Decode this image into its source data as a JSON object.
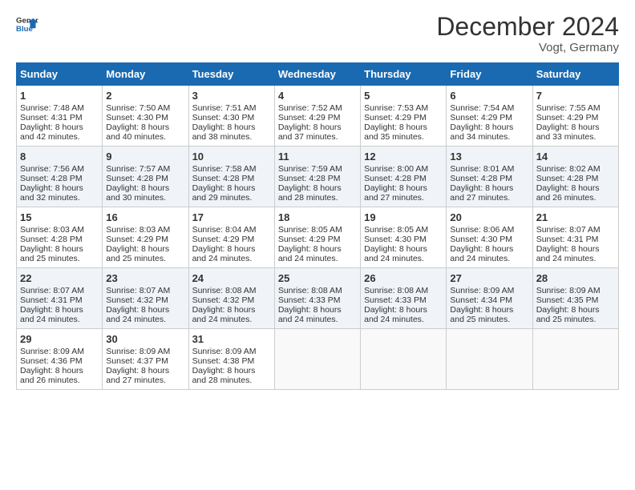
{
  "header": {
    "logo_line1": "General",
    "logo_line2": "Blue",
    "month": "December 2024",
    "location": "Vogt, Germany"
  },
  "days_of_week": [
    "Sunday",
    "Monday",
    "Tuesday",
    "Wednesday",
    "Thursday",
    "Friday",
    "Saturday"
  ],
  "weeks": [
    [
      {
        "day": "1",
        "sunrise": "Sunrise: 7:48 AM",
        "sunset": "Sunset: 4:31 PM",
        "daylight": "Daylight: 8 hours and 42 minutes."
      },
      {
        "day": "2",
        "sunrise": "Sunrise: 7:50 AM",
        "sunset": "Sunset: 4:30 PM",
        "daylight": "Daylight: 8 hours and 40 minutes."
      },
      {
        "day": "3",
        "sunrise": "Sunrise: 7:51 AM",
        "sunset": "Sunset: 4:30 PM",
        "daylight": "Daylight: 8 hours and 38 minutes."
      },
      {
        "day": "4",
        "sunrise": "Sunrise: 7:52 AM",
        "sunset": "Sunset: 4:29 PM",
        "daylight": "Daylight: 8 hours and 37 minutes."
      },
      {
        "day": "5",
        "sunrise": "Sunrise: 7:53 AM",
        "sunset": "Sunset: 4:29 PM",
        "daylight": "Daylight: 8 hours and 35 minutes."
      },
      {
        "day": "6",
        "sunrise": "Sunrise: 7:54 AM",
        "sunset": "Sunset: 4:29 PM",
        "daylight": "Daylight: 8 hours and 34 minutes."
      },
      {
        "day": "7",
        "sunrise": "Sunrise: 7:55 AM",
        "sunset": "Sunset: 4:29 PM",
        "daylight": "Daylight: 8 hours and 33 minutes."
      }
    ],
    [
      {
        "day": "8",
        "sunrise": "Sunrise: 7:56 AM",
        "sunset": "Sunset: 4:28 PM",
        "daylight": "Daylight: 8 hours and 32 minutes."
      },
      {
        "day": "9",
        "sunrise": "Sunrise: 7:57 AM",
        "sunset": "Sunset: 4:28 PM",
        "daylight": "Daylight: 8 hours and 30 minutes."
      },
      {
        "day": "10",
        "sunrise": "Sunrise: 7:58 AM",
        "sunset": "Sunset: 4:28 PM",
        "daylight": "Daylight: 8 hours and 29 minutes."
      },
      {
        "day": "11",
        "sunrise": "Sunrise: 7:59 AM",
        "sunset": "Sunset: 4:28 PM",
        "daylight": "Daylight: 8 hours and 28 minutes."
      },
      {
        "day": "12",
        "sunrise": "Sunrise: 8:00 AM",
        "sunset": "Sunset: 4:28 PM",
        "daylight": "Daylight: 8 hours and 27 minutes."
      },
      {
        "day": "13",
        "sunrise": "Sunrise: 8:01 AM",
        "sunset": "Sunset: 4:28 PM",
        "daylight": "Daylight: 8 hours and 27 minutes."
      },
      {
        "day": "14",
        "sunrise": "Sunrise: 8:02 AM",
        "sunset": "Sunset: 4:28 PM",
        "daylight": "Daylight: 8 hours and 26 minutes."
      }
    ],
    [
      {
        "day": "15",
        "sunrise": "Sunrise: 8:03 AM",
        "sunset": "Sunset: 4:28 PM",
        "daylight": "Daylight: 8 hours and 25 minutes."
      },
      {
        "day": "16",
        "sunrise": "Sunrise: 8:03 AM",
        "sunset": "Sunset: 4:29 PM",
        "daylight": "Daylight: 8 hours and 25 minutes."
      },
      {
        "day": "17",
        "sunrise": "Sunrise: 8:04 AM",
        "sunset": "Sunset: 4:29 PM",
        "daylight": "Daylight: 8 hours and 24 minutes."
      },
      {
        "day": "18",
        "sunrise": "Sunrise: 8:05 AM",
        "sunset": "Sunset: 4:29 PM",
        "daylight": "Daylight: 8 hours and 24 minutes."
      },
      {
        "day": "19",
        "sunrise": "Sunrise: 8:05 AM",
        "sunset": "Sunset: 4:30 PM",
        "daylight": "Daylight: 8 hours and 24 minutes."
      },
      {
        "day": "20",
        "sunrise": "Sunrise: 8:06 AM",
        "sunset": "Sunset: 4:30 PM",
        "daylight": "Daylight: 8 hours and 24 minutes."
      },
      {
        "day": "21",
        "sunrise": "Sunrise: 8:07 AM",
        "sunset": "Sunset: 4:31 PM",
        "daylight": "Daylight: 8 hours and 24 minutes."
      }
    ],
    [
      {
        "day": "22",
        "sunrise": "Sunrise: 8:07 AM",
        "sunset": "Sunset: 4:31 PM",
        "daylight": "Daylight: 8 hours and 24 minutes."
      },
      {
        "day": "23",
        "sunrise": "Sunrise: 8:07 AM",
        "sunset": "Sunset: 4:32 PM",
        "daylight": "Daylight: 8 hours and 24 minutes."
      },
      {
        "day": "24",
        "sunrise": "Sunrise: 8:08 AM",
        "sunset": "Sunset: 4:32 PM",
        "daylight": "Daylight: 8 hours and 24 minutes."
      },
      {
        "day": "25",
        "sunrise": "Sunrise: 8:08 AM",
        "sunset": "Sunset: 4:33 PM",
        "daylight": "Daylight: 8 hours and 24 minutes."
      },
      {
        "day": "26",
        "sunrise": "Sunrise: 8:08 AM",
        "sunset": "Sunset: 4:33 PM",
        "daylight": "Daylight: 8 hours and 24 minutes."
      },
      {
        "day": "27",
        "sunrise": "Sunrise: 8:09 AM",
        "sunset": "Sunset: 4:34 PM",
        "daylight": "Daylight: 8 hours and 25 minutes."
      },
      {
        "day": "28",
        "sunrise": "Sunrise: 8:09 AM",
        "sunset": "Sunset: 4:35 PM",
        "daylight": "Daylight: 8 hours and 25 minutes."
      }
    ],
    [
      {
        "day": "29",
        "sunrise": "Sunrise: 8:09 AM",
        "sunset": "Sunset: 4:36 PM",
        "daylight": "Daylight: 8 hours and 26 minutes."
      },
      {
        "day": "30",
        "sunrise": "Sunrise: 8:09 AM",
        "sunset": "Sunset: 4:37 PM",
        "daylight": "Daylight: 8 hours and 27 minutes."
      },
      {
        "day": "31",
        "sunrise": "Sunrise: 8:09 AM",
        "sunset": "Sunset: 4:38 PM",
        "daylight": "Daylight: 8 hours and 28 minutes."
      },
      null,
      null,
      null,
      null
    ]
  ]
}
